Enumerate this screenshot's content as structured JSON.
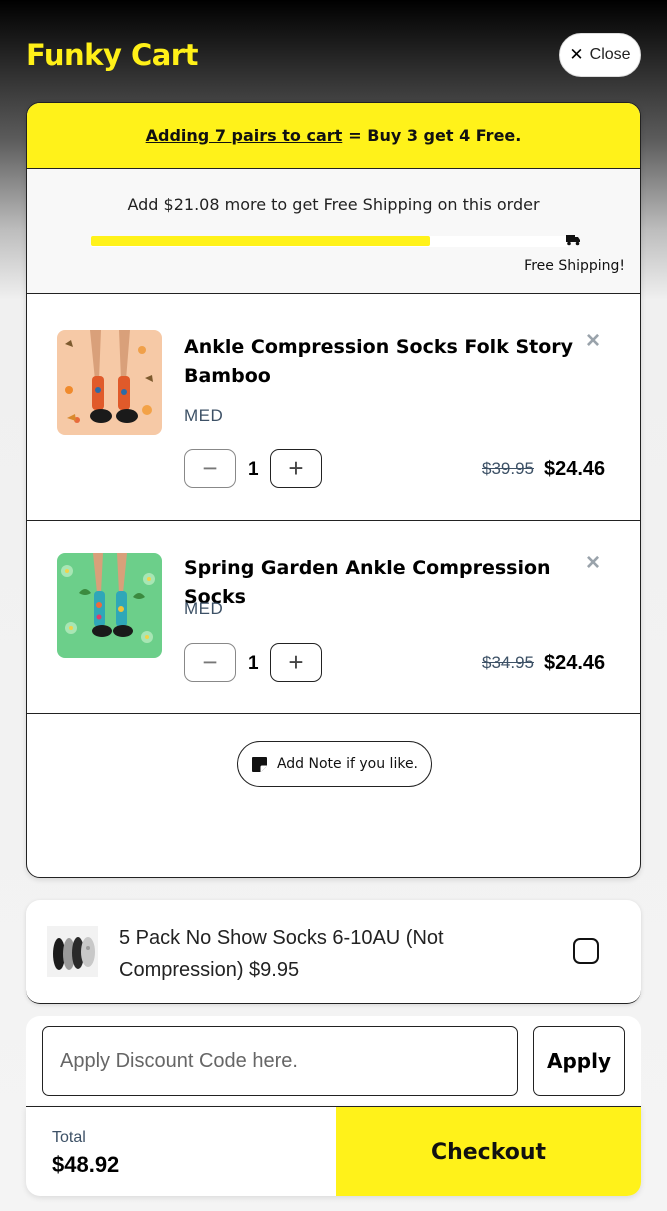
{
  "header": {
    "brand": "Funky Cart",
    "close_label": "Close"
  },
  "promo": {
    "link_text": "Adding 7 pairs to cart",
    "rest_text": "= Buy 3 get 4 Free."
  },
  "shipping": {
    "message": "Add $21.08 more to get Free Shipping on this order",
    "progress_fraction": 0.71,
    "goal_label": "Free Shipping!"
  },
  "items": [
    {
      "title": "Ankle Compression Socks Folk Story Bamboo",
      "variant": "MED",
      "quantity": "1",
      "price_old": "$39.95",
      "price_new": "$24.46",
      "image_icon": "sock-peach-butterflies-image"
    },
    {
      "title": "Spring Garden Ankle Compression Socks",
      "variant": "MED",
      "quantity": "1",
      "price_old": "$34.95",
      "price_new": "$24.46",
      "image_icon": "sock-green-daisies-image"
    }
  ],
  "note": {
    "label": "Add Note if you like."
  },
  "upsell": {
    "text": "5 Pack No Show Socks 6-10AU (Not Compression) $9.95",
    "checked": false
  },
  "discount": {
    "placeholder": "Apply Discount Code here.",
    "apply_label": "Apply"
  },
  "footer": {
    "total_label": "Total",
    "total_value": "$48.92",
    "checkout_label": "Checkout"
  },
  "colors": {
    "brand_yellow": "#fff21a",
    "text_muted": "#3d5166"
  }
}
